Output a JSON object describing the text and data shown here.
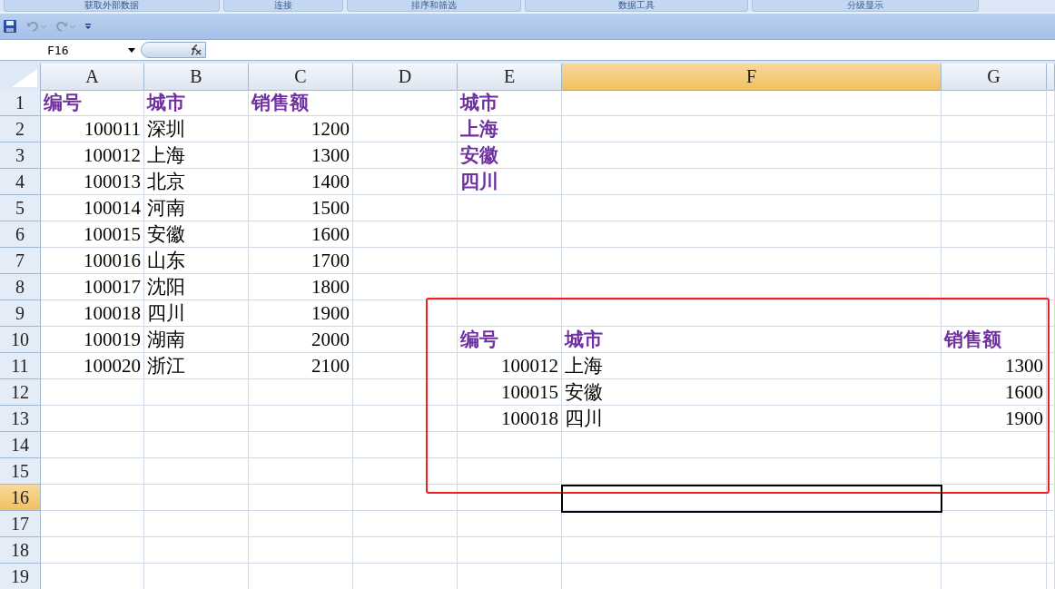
{
  "ribbon_groups": [
    "获取外部数据",
    "连接",
    "排序和筛选",
    "数据工具",
    "分级显示"
  ],
  "name_box": {
    "value": "F16"
  },
  "columns": [
    {
      "label": "A",
      "selected": false
    },
    {
      "label": "B",
      "selected": false
    },
    {
      "label": "C",
      "selected": false
    },
    {
      "label": "D",
      "selected": false
    },
    {
      "label": "E",
      "selected": false
    },
    {
      "label": "F",
      "selected": true
    },
    {
      "label": "G",
      "selected": false
    }
  ],
  "rows": [
    {
      "number": "1",
      "selected": false,
      "cells": {
        "A": {
          "kind": "header",
          "text": "编号"
        },
        "B": {
          "kind": "header",
          "text": "城市"
        },
        "C": {
          "kind": "header",
          "text": "销售额"
        },
        "E": {
          "kind": "header",
          "text": "城市"
        }
      }
    },
    {
      "number": "2",
      "selected": false,
      "cells": {
        "A": {
          "kind": "number",
          "text": "100011"
        },
        "B": {
          "kind": "text",
          "text": "深圳"
        },
        "C": {
          "kind": "number",
          "text": "1200"
        },
        "E": {
          "kind": "header",
          "text": "上海"
        }
      }
    },
    {
      "number": "3",
      "selected": false,
      "cells": {
        "A": {
          "kind": "number",
          "text": "100012"
        },
        "B": {
          "kind": "text",
          "text": "上海"
        },
        "C": {
          "kind": "number",
          "text": "1300"
        },
        "E": {
          "kind": "header",
          "text": "安徽"
        }
      }
    },
    {
      "number": "4",
      "selected": false,
      "cells": {
        "A": {
          "kind": "number",
          "text": "100013"
        },
        "B": {
          "kind": "text",
          "text": "北京"
        },
        "C": {
          "kind": "number",
          "text": "1400"
        },
        "E": {
          "kind": "header",
          "text": "四川"
        }
      }
    },
    {
      "number": "5",
      "selected": false,
      "cells": {
        "A": {
          "kind": "number",
          "text": "100014"
        },
        "B": {
          "kind": "text",
          "text": "河南"
        },
        "C": {
          "kind": "number",
          "text": "1500"
        }
      }
    },
    {
      "number": "6",
      "selected": false,
      "cells": {
        "A": {
          "kind": "number",
          "text": "100015"
        },
        "B": {
          "kind": "text",
          "text": "安徽"
        },
        "C": {
          "kind": "number",
          "text": "1600"
        }
      }
    },
    {
      "number": "7",
      "selected": false,
      "cells": {
        "A": {
          "kind": "number",
          "text": "100016"
        },
        "B": {
          "kind": "text",
          "text": "山东"
        },
        "C": {
          "kind": "number",
          "text": "1700"
        }
      }
    },
    {
      "number": "8",
      "selected": false,
      "cells": {
        "A": {
          "kind": "number",
          "text": "100017"
        },
        "B": {
          "kind": "text",
          "text": "沈阳"
        },
        "C": {
          "kind": "number",
          "text": "1800"
        }
      }
    },
    {
      "number": "9",
      "selected": false,
      "cells": {
        "A": {
          "kind": "number",
          "text": "100018"
        },
        "B": {
          "kind": "text",
          "text": "四川"
        },
        "C": {
          "kind": "number",
          "text": "1900"
        }
      }
    },
    {
      "number": "10",
      "selected": false,
      "cells": {
        "A": {
          "kind": "number",
          "text": "100019"
        },
        "B": {
          "kind": "text",
          "text": "湖南"
        },
        "C": {
          "kind": "number",
          "text": "2000"
        },
        "E": {
          "kind": "header",
          "text": "编号"
        },
        "F": {
          "kind": "header",
          "text": "城市"
        },
        "G": {
          "kind": "header",
          "text": "销售额"
        }
      }
    },
    {
      "number": "11",
      "selected": false,
      "cells": {
        "A": {
          "kind": "number",
          "text": "100020"
        },
        "B": {
          "kind": "text",
          "text": "浙江"
        },
        "C": {
          "kind": "number",
          "text": "2100"
        },
        "E": {
          "kind": "number",
          "text": "100012"
        },
        "F": {
          "kind": "text",
          "text": "上海"
        },
        "G": {
          "kind": "number",
          "text": "1300"
        }
      }
    },
    {
      "number": "12",
      "selected": false,
      "cells": {
        "E": {
          "kind": "number",
          "text": "100015"
        },
        "F": {
          "kind": "text",
          "text": "安徽"
        },
        "G": {
          "kind": "number",
          "text": "1600"
        }
      }
    },
    {
      "number": "13",
      "selected": false,
      "cells": {
        "E": {
          "kind": "number",
          "text": "100018"
        },
        "F": {
          "kind": "text",
          "text": "四川"
        },
        "G": {
          "kind": "number",
          "text": "1900"
        }
      }
    },
    {
      "number": "14",
      "selected": false,
      "cells": {}
    },
    {
      "number": "15",
      "selected": false,
      "cells": {}
    },
    {
      "number": "16",
      "selected": true,
      "cells": {
        "F": {
          "selected": true
        }
      }
    },
    {
      "number": "17",
      "selected": false,
      "cells": {}
    },
    {
      "number": "18",
      "selected": false,
      "cells": {}
    },
    {
      "number": "19",
      "selected": false,
      "cells": {}
    }
  ]
}
